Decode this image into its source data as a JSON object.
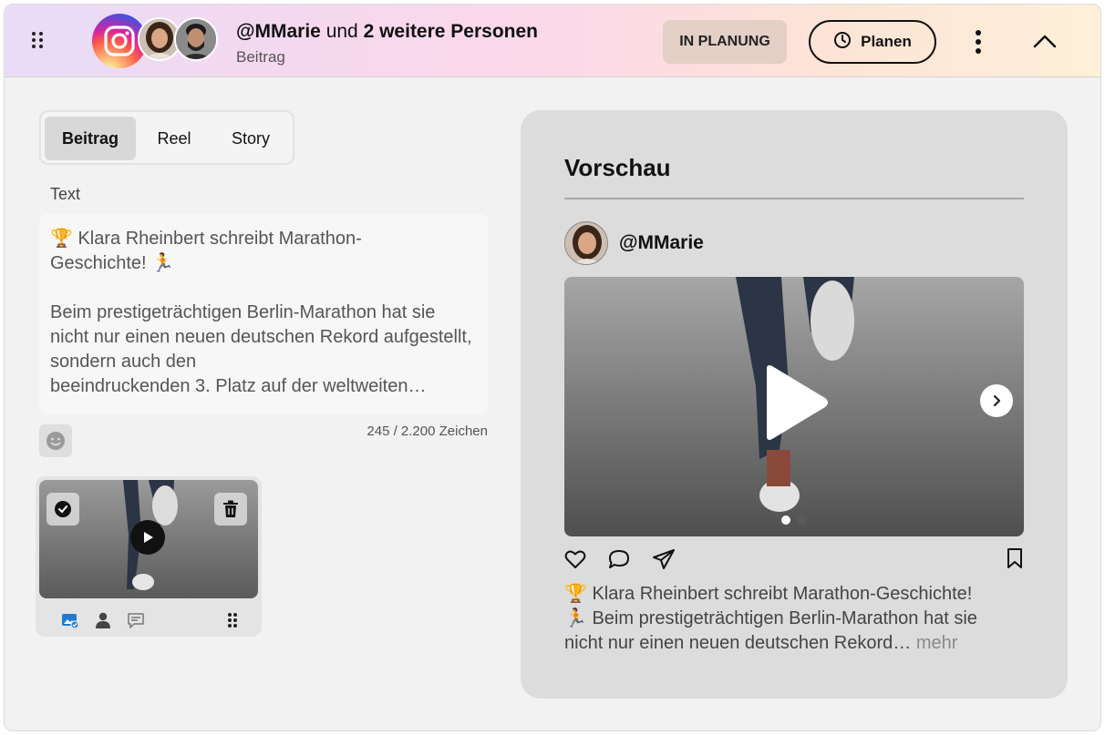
{
  "header": {
    "user": "@MMarie",
    "connector": "und",
    "others": "2 weitere Personen",
    "post_type": "Beitrag",
    "status": "IN PLANUNG",
    "plan_label": "Planen"
  },
  "tabs": [
    {
      "label": "Beitrag",
      "active": true
    },
    {
      "label": "Reel",
      "active": false
    },
    {
      "label": "Story",
      "active": false
    }
  ],
  "editor": {
    "label": "Text",
    "line1": "Klara Rheinbert schreibt Marathon-",
    "line2": "Geschichte!",
    "para": "Beim prestigeträchtigen Berlin-Marathon hat sie nicht nur einen neuen deutschen Rekord aufgestellt, sondern auch den",
    "last_line": "beeindruckenden 3. Platz auf der weltweiten…",
    "counter": "245 / 2.200 Zeichen"
  },
  "preview": {
    "title": "Vorschau",
    "username": "@MMarie",
    "caption_line1": "Klara Rheinbert schreibt Marathon-Geschichte!",
    "caption_line2": "Beim prestigeträchtigen Berlin-Marathon hat sie",
    "caption_line3": "nicht nur einen neuen deutschen Rekord…",
    "more": "mehr"
  },
  "colors": {
    "status_bg": "#e3cfc6",
    "card_bg": "#f2f2f2",
    "preview_bg": "#dcdcdc",
    "accent_blue": "#1f7ad1"
  },
  "icons": [
    "drag-handle-icon",
    "instagram-icon",
    "clock-icon",
    "more-vertical-icon",
    "chevron-up-icon",
    "emoji-icon",
    "check-icon",
    "trash-icon",
    "play-icon",
    "image-check-icon",
    "person-icon",
    "comment-icon",
    "grip-icon",
    "chevron-right-icon",
    "heart-icon",
    "comment-icon",
    "send-icon",
    "bookmark-icon"
  ]
}
